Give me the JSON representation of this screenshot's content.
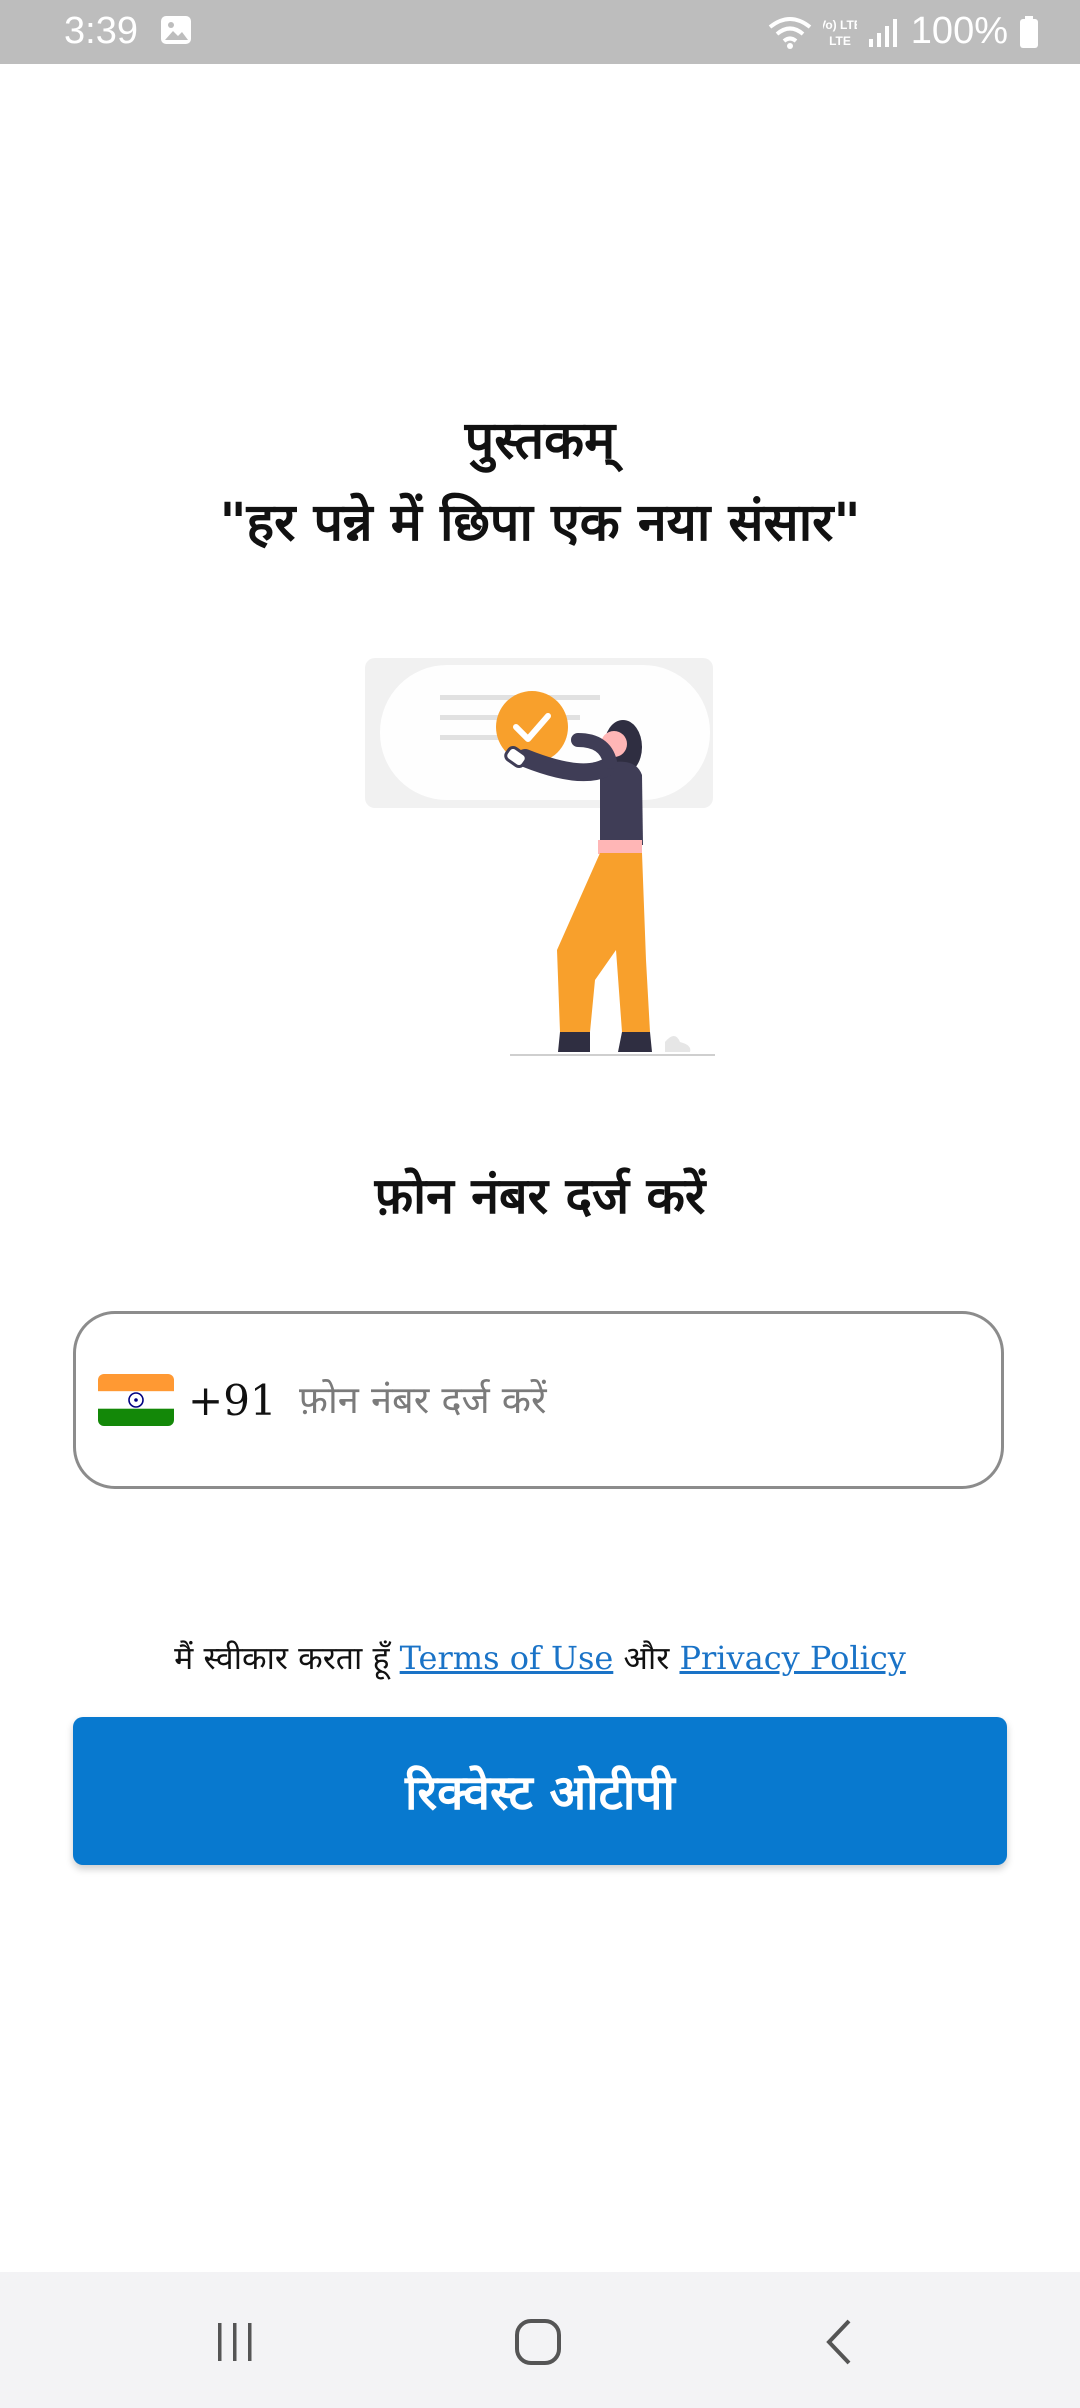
{
  "status_bar": {
    "time": "3:39",
    "battery": "100%",
    "network": "Vo) LTE"
  },
  "header": {
    "app_name": "पुस्तकम्",
    "tagline": "\"हर पन्ने में छिपा एक नया संसार\""
  },
  "login": {
    "heading": "फ़ोन नंबर दर्ज करें",
    "country_code": "+91",
    "phone_placeholder": "फ़ोन नंबर दर्ज करें",
    "phone_value": ""
  },
  "terms": {
    "prefix": "मैं स्वीकार करता हूँ",
    "terms_link": "Terms of Use",
    "conjunction": "और",
    "privacy_link": "Privacy Policy"
  },
  "button": {
    "label": "रिक्वेस्ट ओटीपी"
  },
  "icons": {
    "flag": "india-flag-icon",
    "gallery": "image-icon",
    "recent": "recent-apps-icon",
    "home": "home-icon",
    "back": "back-icon"
  },
  "colors": {
    "accent": "#0879cf",
    "link": "#1a73c7",
    "illustration_orange": "#f8a02c",
    "illustration_dark": "#3f3d56"
  }
}
